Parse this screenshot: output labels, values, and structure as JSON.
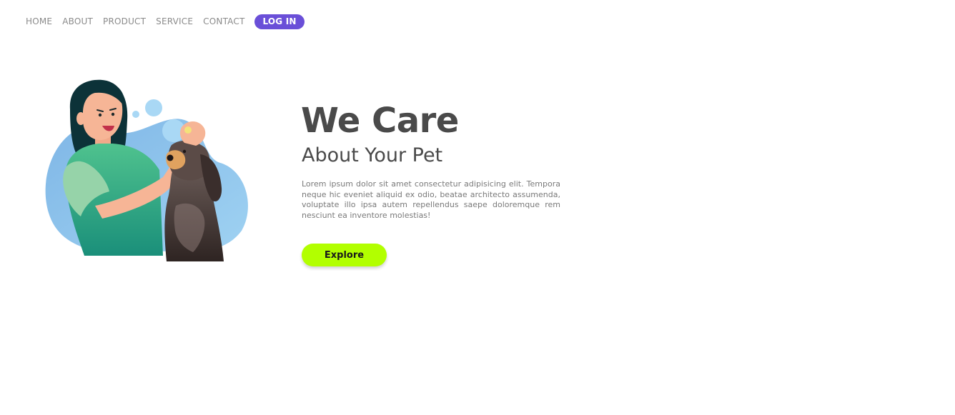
{
  "nav": {
    "items": [
      {
        "label": "HOME"
      },
      {
        "label": "ABOUT"
      },
      {
        "label": "PRODUCT"
      },
      {
        "label": "SERVICE"
      },
      {
        "label": "CONTACT"
      }
    ],
    "login_label": "LOG IN"
  },
  "hero": {
    "title": "We Care",
    "subtitle": "About Your Pet",
    "body": "Lorem ipsum dolor sit amet consectetur adipisicing elit. Tempora neque hic eveniet aliquid ex odio, beatae architecto assumenda, voluptate illo ipsa autem repellendus saepe doloremque rem nesciunt ea inventore molestias!",
    "cta_label": "Explore"
  },
  "colors": {
    "accent": "#6a4fd8",
    "cta": "#b2ff00",
    "heading": "#4a4a4a"
  }
}
